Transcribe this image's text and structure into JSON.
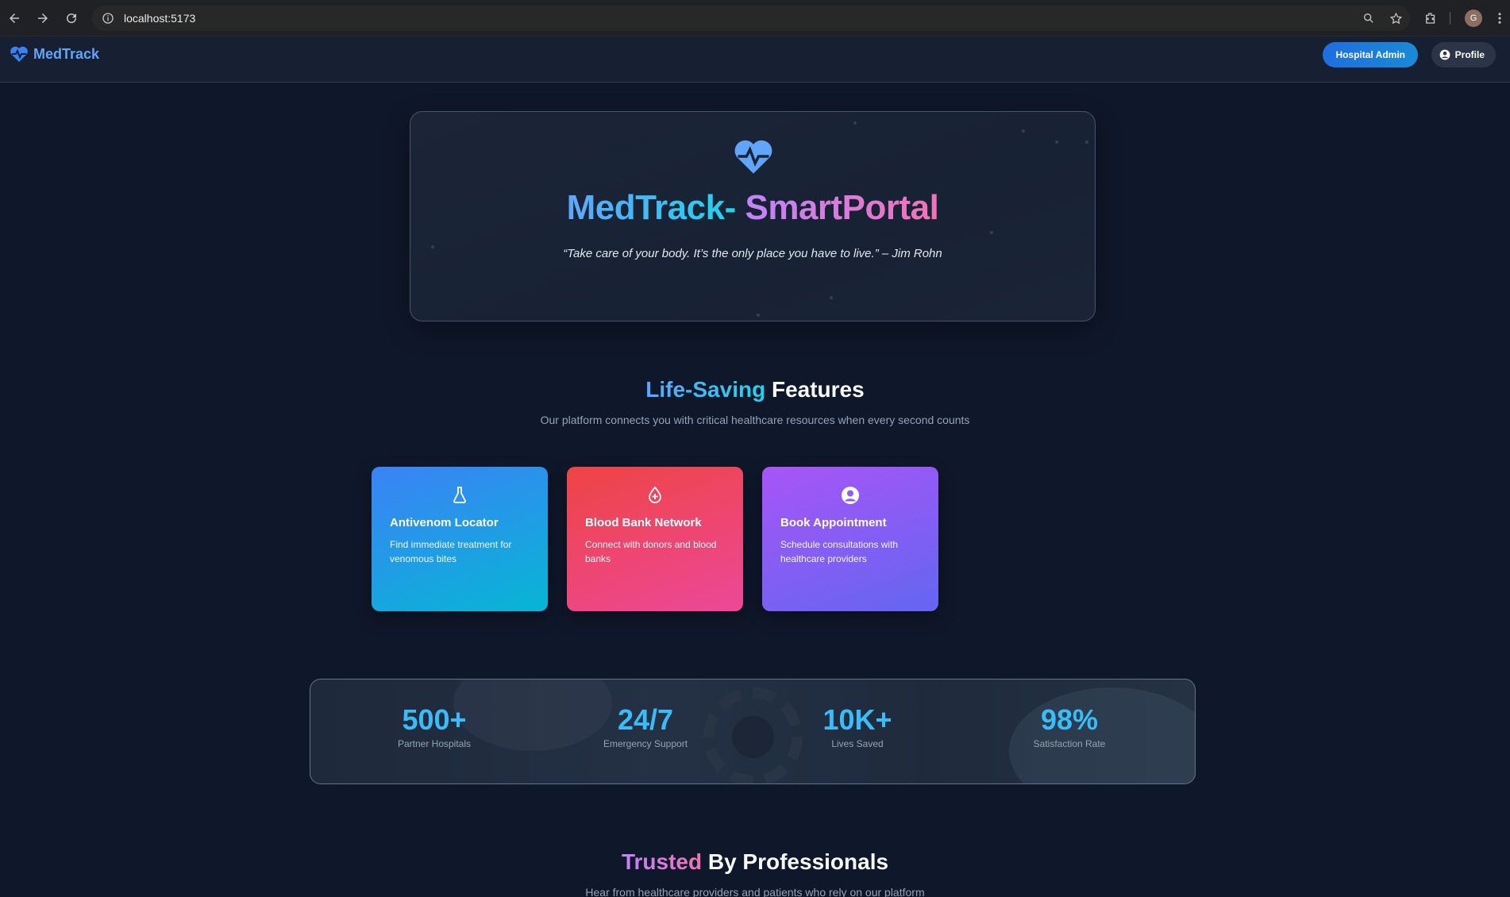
{
  "browser": {
    "url": "localhost:5173",
    "profile_initial": "G"
  },
  "header": {
    "brand": "MedTrack",
    "admin_button": "Hospital Admin",
    "profile_button": "Profile"
  },
  "hero": {
    "title_part1": "MedTrack-",
    "title_part2": "SmartPortal",
    "quote": "“Take care of your body. It’s the only place you have to live.” – Jim Rohn"
  },
  "features": {
    "title_accent": "Life-Saving",
    "title_rest": "Features",
    "subtitle": "Our platform connects you with critical healthcare resources when every second counts",
    "cards": [
      {
        "title": "Antivenom Locator",
        "description": "Find immediate treatment for venomous bites",
        "icon": "flask-icon"
      },
      {
        "title": "Blood Bank Network",
        "description": "Connect with donors and blood banks",
        "icon": "blood-drop-icon"
      },
      {
        "title": "Book Appointment",
        "description": "Schedule consultations with healthcare providers",
        "icon": "user-circle-icon"
      }
    ]
  },
  "stats": [
    {
      "value": "500+",
      "label": "Partner Hospitals"
    },
    {
      "value": "24/7",
      "label": "Emergency Support"
    },
    {
      "value": "10K+",
      "label": "Lives Saved"
    },
    {
      "value": "98%",
      "label": "Satisfaction Rate"
    }
  ],
  "testimonials": {
    "title_accent": "Trusted",
    "title_rest": "By Professionals",
    "subtitle": "Hear from healthcare providers and patients who rely on our platform"
  },
  "colors": {
    "background": "#0f172a",
    "accent_blue": "#38bdf8",
    "accent_pink": "#f472b6",
    "accent_purple": "#c084fc"
  }
}
